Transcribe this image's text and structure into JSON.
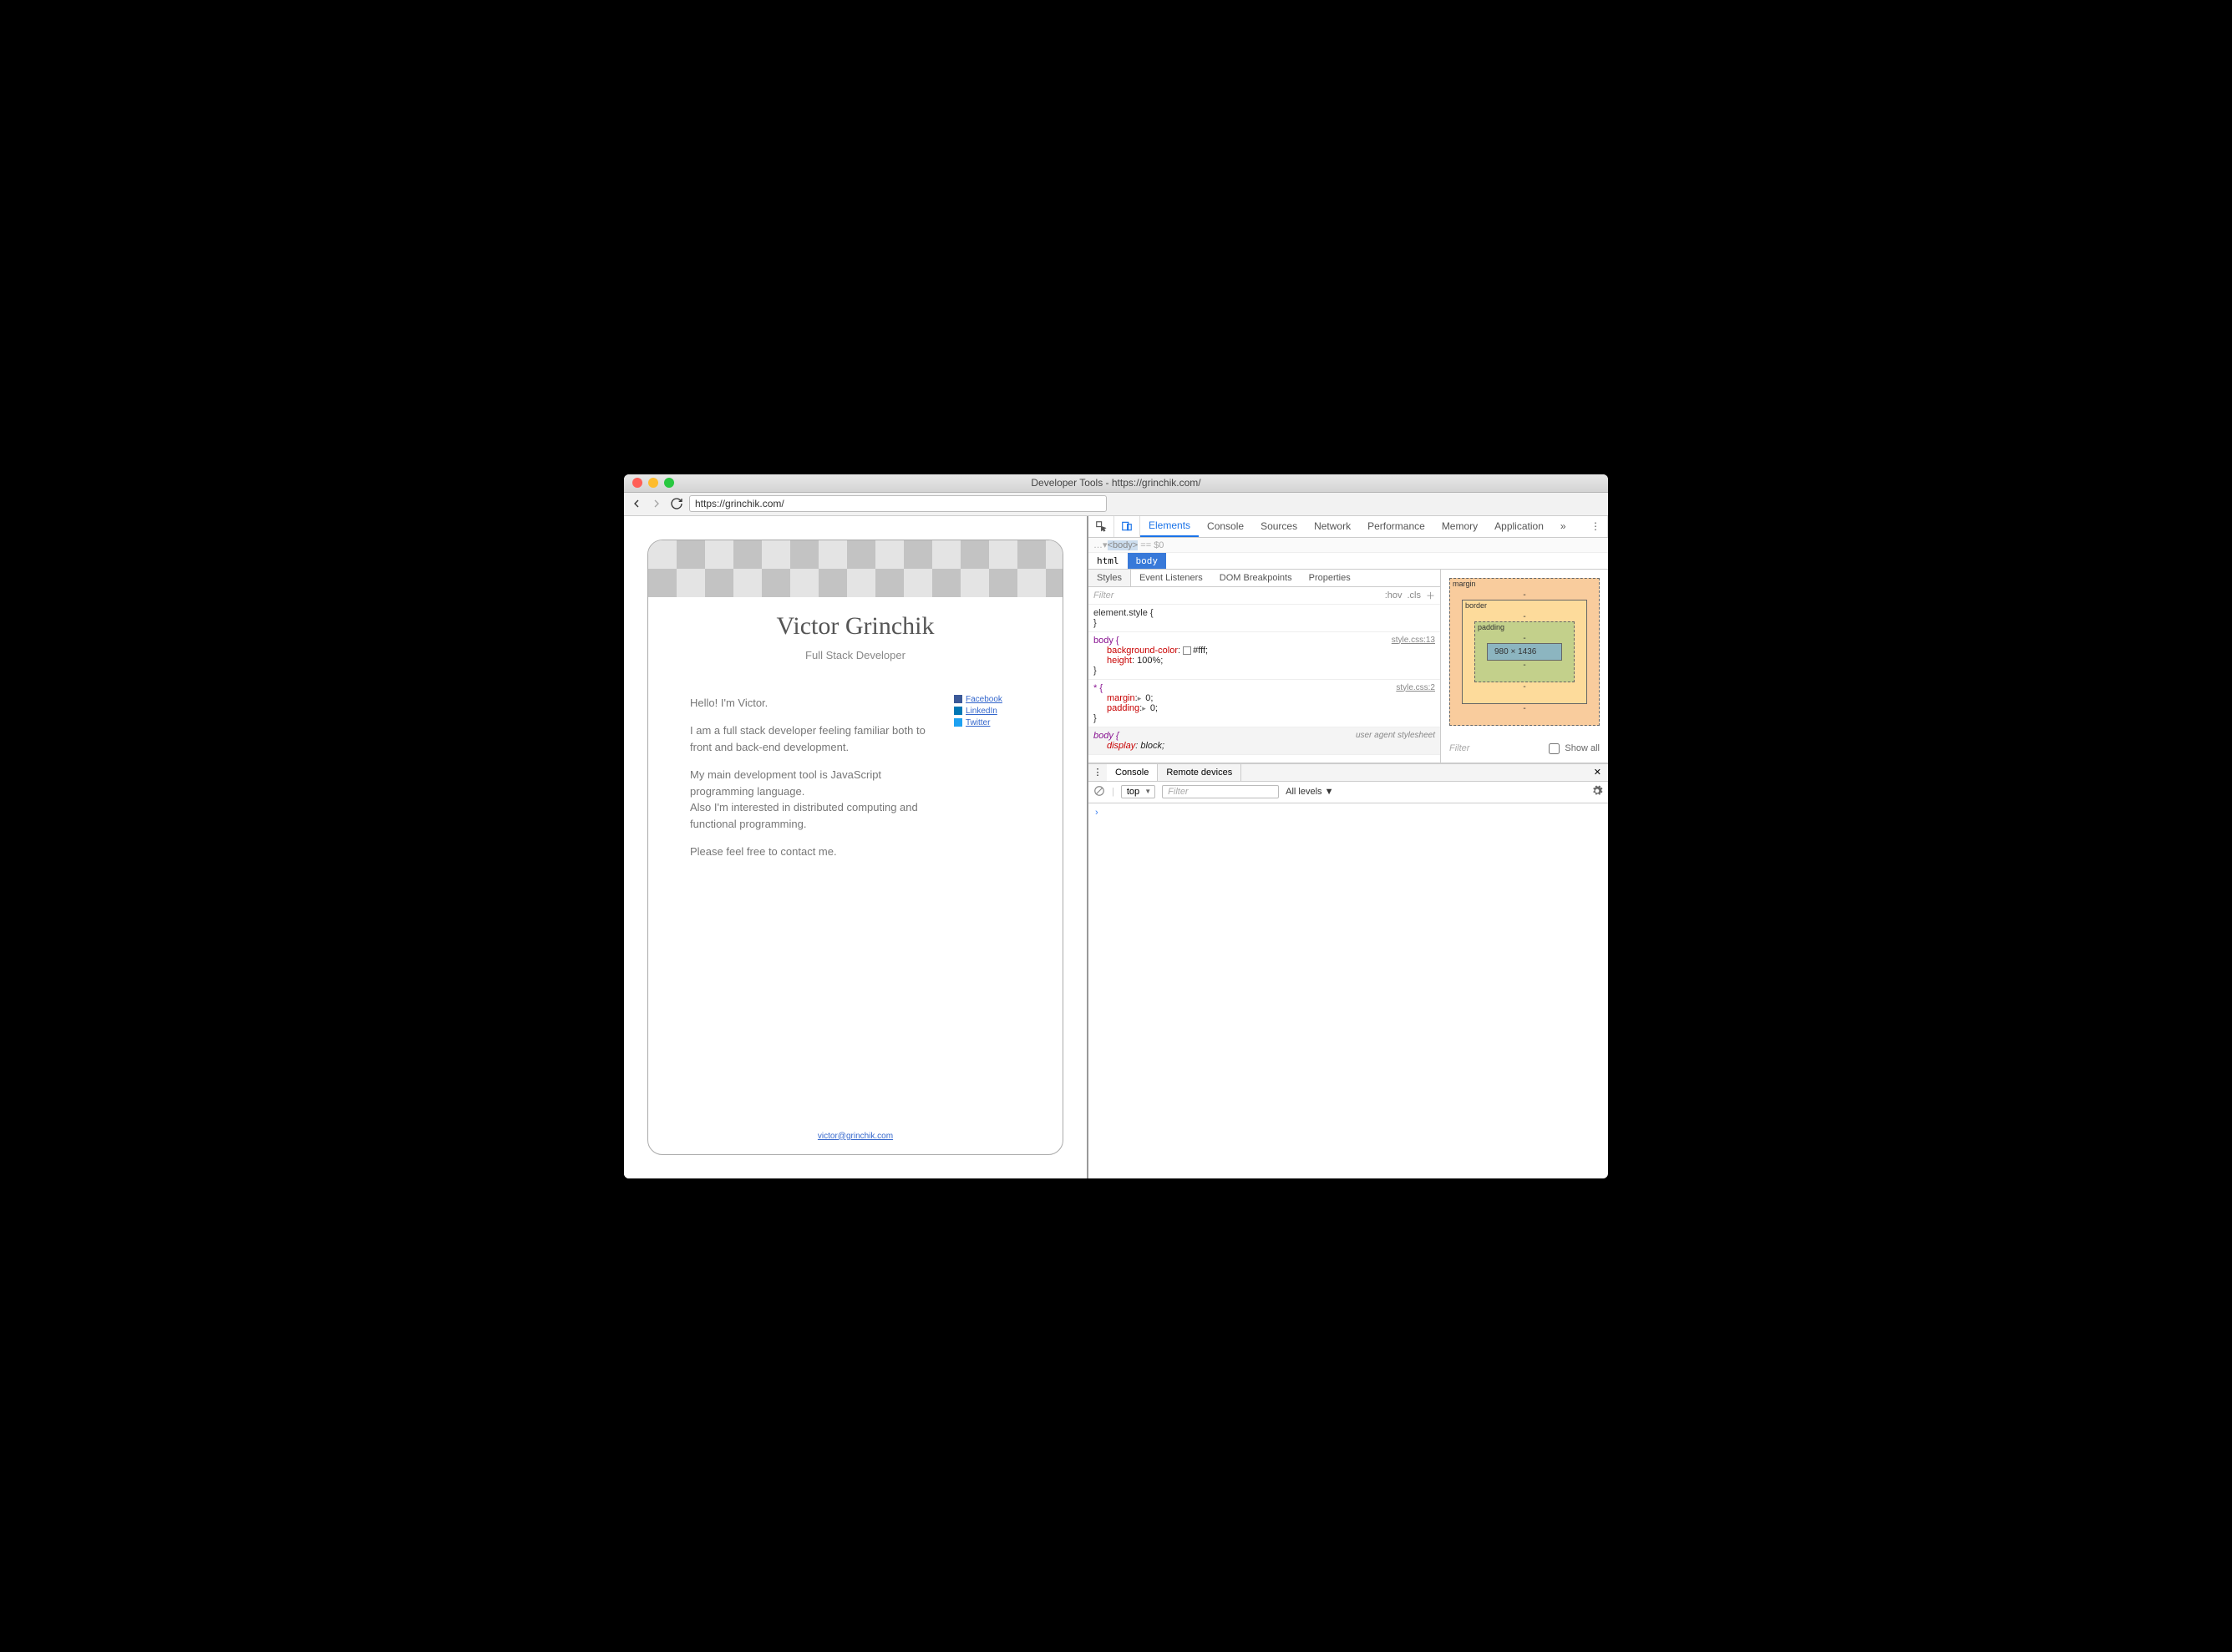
{
  "window": {
    "title": "Developer Tools - https://grinchik.com/"
  },
  "addressbar": {
    "url": "https://grinchik.com/"
  },
  "page": {
    "name": "Victor Grinchik",
    "subtitle": "Full Stack Developer",
    "p1": "Hello! I'm Victor.",
    "p2": "I am a full stack developer feeling familiar both to front and back-end development.",
    "p3a": "My main development tool is JavaScript programming language.",
    "p3b": "Also I'm interested in distributed computing and functional programming.",
    "p4": "Please feel free to contact me.",
    "social": {
      "fb": "Facebook",
      "li": "LinkedIn",
      "tw": "Twitter"
    },
    "email": "victor@grinchik.com"
  },
  "devtools": {
    "tabs": [
      "Elements",
      "Console",
      "Sources",
      "Network",
      "Performance",
      "Memory",
      "Application"
    ],
    "active_tab": "Elements",
    "domline_prefix": "…▾",
    "domline_tag": "<body>",
    "domline_suffix": " == $0",
    "breadcrumb": [
      "html",
      "body"
    ],
    "style_tabs": [
      "Styles",
      "Event Listeners",
      "DOM Breakpoints",
      "Properties"
    ],
    "filter_placeholder": "Filter",
    "hov": ":hov",
    "cls": ".cls",
    "rules": {
      "r0": {
        "selector": "element.style {",
        "close": "}"
      },
      "r1": {
        "selector": "body {",
        "link": "style.css:13",
        "l1p": "background-color",
        "l1v": "#fff;",
        "l2p": "height",
        "l2v": "100%;",
        "close": "}"
      },
      "r2": {
        "selector": "* {",
        "link": "style.css:2",
        "l1p": "margin",
        "l1v": "0;",
        "l2p": "padding",
        "l2v": "0;",
        "close": "}"
      },
      "r3": {
        "selector": "body {",
        "link": "user agent stylesheet",
        "l1p": "display",
        "l1v": "block;"
      }
    },
    "boxmodel": {
      "margin": "margin",
      "border": "border",
      "padding": "padding",
      "content": "980 × 1436",
      "dash": "-"
    },
    "side_filter_placeholder": "Filter",
    "side_showall": "Show all",
    "drawer": {
      "tabs": [
        "Console",
        "Remote devices"
      ]
    },
    "console": {
      "context": "top",
      "filter_placeholder": "Filter",
      "levels": "All levels ▼"
    }
  }
}
